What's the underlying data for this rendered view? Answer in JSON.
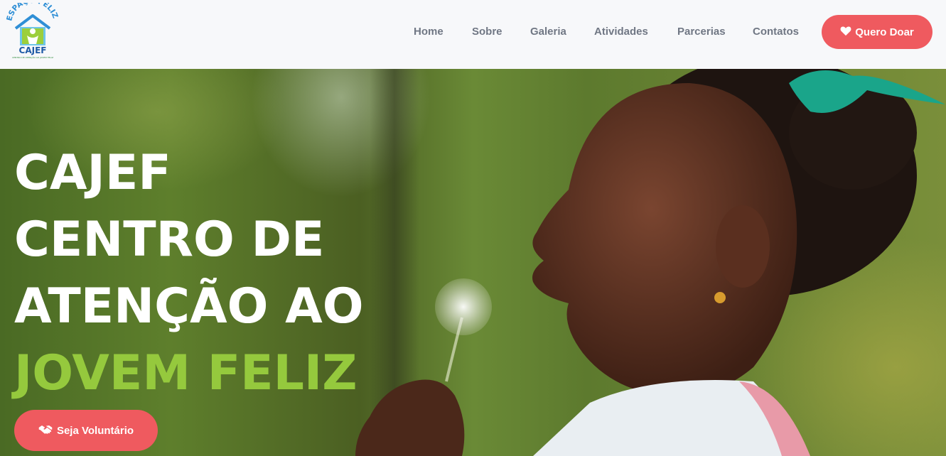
{
  "brand": {
    "logo_text": "ESPAÇO FELIZ",
    "logo_name": "CAJEF",
    "logo_tagline": "CENTRO DE ATENÇÃO AO JOVEM FELIZ"
  },
  "nav": {
    "items": [
      {
        "label": "Home"
      },
      {
        "label": "Sobre"
      },
      {
        "label": "Galeria"
      },
      {
        "label": "Atividades"
      },
      {
        "label": "Parcerias"
      },
      {
        "label": "Contatos"
      }
    ],
    "donate_label": "Quero Doar",
    "donate_icon": "heart-icon"
  },
  "hero": {
    "title_lines": [
      "CAJEF",
      "CENTRO DE",
      "ATENÇÃO AO"
    ],
    "title_accent": "JOVEM FELIZ",
    "volunteer_label": "Seja Voluntário",
    "volunteer_icon": "handshake-icon"
  },
  "colors": {
    "accent_red": "#ef5a5f",
    "accent_green": "#95c93d",
    "nav_text": "#707784",
    "header_bg": "#f7f8fa"
  }
}
